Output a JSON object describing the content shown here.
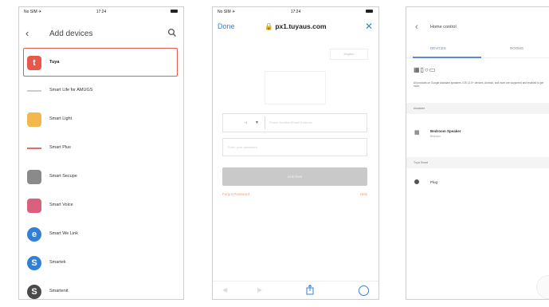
{
  "panel1": {
    "status": {
      "left": "No SIM ✈",
      "time": "17:24"
    },
    "title": "Add devices",
    "devices": [
      {
        "label": "Tuya",
        "icon": "tuya-logo-icon",
        "color": "#e8574a",
        "shape": "sq",
        "text": "t"
      },
      {
        "label": "Smart Life for AMUGS",
        "icon": "smart-life-icon",
        "color": "#cccccc",
        "shape": "line",
        "text": ""
      },
      {
        "label": "Smart Light",
        "icon": "light-icon",
        "color": "#f2b84b",
        "shape": "sq",
        "text": ""
      },
      {
        "label": "Smart Plus",
        "icon": "smart-plus-icon",
        "color": "#e26b67",
        "shape": "line",
        "text": ""
      },
      {
        "label": "Smart Secupe",
        "icon": "camera-icon",
        "color": "#8a8a8a",
        "shape": "sq",
        "text": ""
      },
      {
        "label": "Smart Voice",
        "icon": "voice-icon",
        "color": "#d9607f",
        "shape": "sq",
        "text": ""
      },
      {
        "label": "Smart We Link",
        "icon": "we-link-icon",
        "color": "#2f80d6",
        "shape": "circ",
        "text": "e"
      },
      {
        "label": "Smartek",
        "icon": "smartek-icon",
        "color": "#2f80d6",
        "shape": "circ",
        "text": "S"
      },
      {
        "label": "Smartenit",
        "icon": "smartenit-icon",
        "color": "#4a4a4a",
        "shape": "circ",
        "text": "S"
      }
    ]
  },
  "panel2": {
    "status": {
      "left": "No SIM ✈",
      "time": "17:24"
    },
    "done": "Done",
    "url": "🔒 px1.tuyaus.com",
    "lang": "English",
    "country_code": "+1",
    "phone_placeholder": "Phone Number/Email Address",
    "password_placeholder": "Enter your password",
    "login": "Link Now",
    "forgot": "Forgot Password",
    "help": "Help"
  },
  "panel3": {
    "title": "Home control",
    "tabs": [
      "DEVICES",
      "ROOMS"
    ],
    "desc": "All products on Google Assistant speakers, iOS 12.0+ devices, Android, and more are supported and enabled to get more.",
    "section1": "Assistant",
    "speaker_name": "Bedroom Speaker",
    "speaker_sub": "Bedroom",
    "section2": "Tuya Smart",
    "plug": "Plug"
  }
}
